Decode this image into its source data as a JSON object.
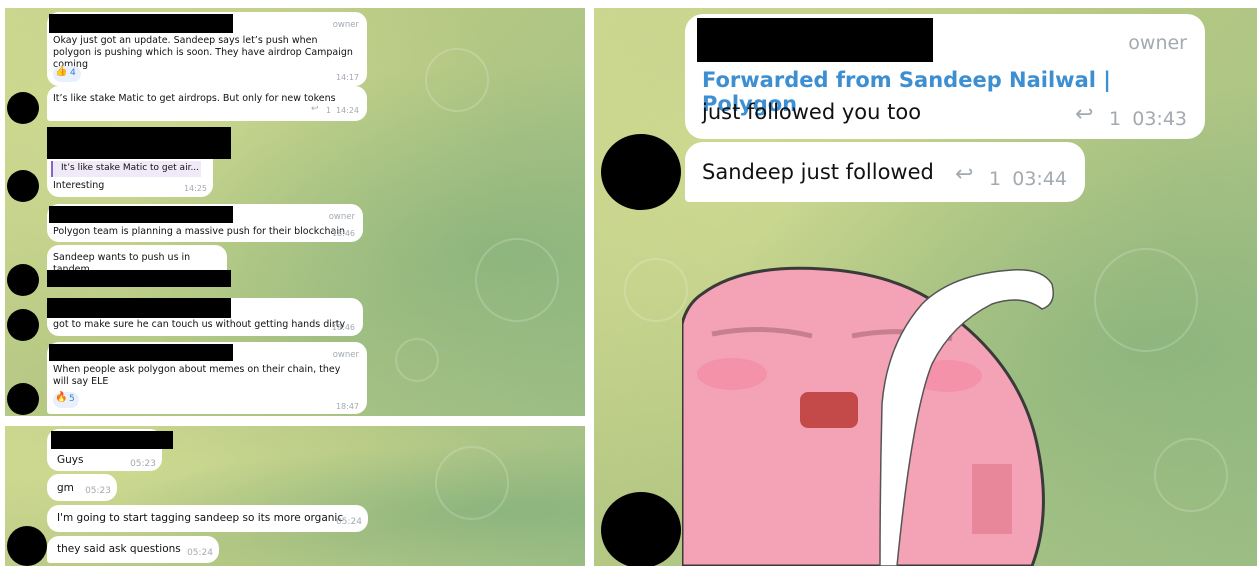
{
  "panel_top_left": {
    "messages": [
      {
        "owner": "owner",
        "text": "Okay just got an update. Sandeep says let’s push when polygon is pushing which is soon. They have airdrop Campaign coming",
        "reaction_emoji": "👍",
        "reaction_count": "4",
        "time": "14:17"
      },
      {
        "text": "It’s like stake Matic to get airdrops. But only for new tokens",
        "reply_count": "1",
        "time": "14:24"
      },
      {
        "quote": "It’s like stake Matic to get air...",
        "text": "Interesting",
        "time": "14:25"
      },
      {
        "owner": "owner",
        "text": "Polygon team is planning a massive push for their blockchain",
        "time": "18:46"
      },
      {
        "text": "Sandeep wants to push us in tandem"
      },
      {
        "text": "got to make sure he can touch us without getting hands dirty",
        "time": "18:46"
      },
      {
        "owner": "owner",
        "text": "When people ask polygon about memes on their chain, they will say ELE",
        "reaction_emoji": "🔥",
        "reaction_count": "5",
        "time": "18:47"
      }
    ]
  },
  "panel_bottom_left": {
    "messages": [
      {
        "text": "Guys",
        "time": "05:23"
      },
      {
        "text": "gm",
        "time": "05:23"
      },
      {
        "text": "I'm going to start tagging sandeep so its more organic",
        "time": "05:24"
      },
      {
        "text": "they said ask questions",
        "time": "05:24"
      }
    ]
  },
  "panel_right": {
    "messages": [
      {
        "owner": "owner",
        "forwarded": "Forwarded from Sandeep Nailwal | Polygon",
        "text": "just followed you too",
        "reply_count": "1",
        "time": "03:43"
      },
      {
        "text": "Sandeep just followed",
        "reply_count": "1",
        "time": "03:44"
      }
    ],
    "sticker": "pink-blob-sticker"
  },
  "colors": {
    "accent": "#3d8fd1",
    "bubble": "#ffffff",
    "redaction": "#000000",
    "wallpaper": "#b5c884"
  },
  "icons": {
    "reply": "reply-arrow-icon"
  }
}
